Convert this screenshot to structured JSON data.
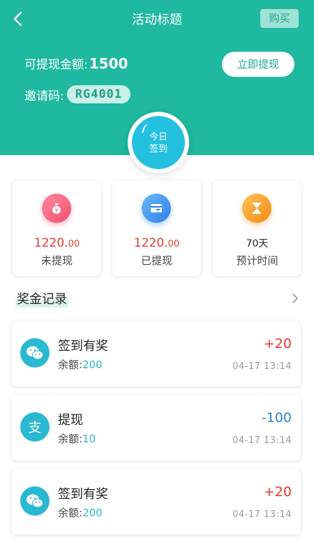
{
  "header": {
    "title": "活动标题",
    "buy_label": "购买",
    "amount_label": "可提现金额:",
    "amount_value": "1500",
    "withdraw_label": "立即提现",
    "invite_label": "邀请码:",
    "invite_code": "RG4001",
    "accent": "#1fb8a0"
  },
  "checkin": {
    "line1": "今日",
    "line2": "签到"
  },
  "stats": [
    {
      "icon": "money-bag-icon",
      "value_main": "1220.",
      "value_dec": "00",
      "label": "未提现",
      "color": "#f46a86"
    },
    {
      "icon": "card-icon",
      "value_main": "1220.",
      "value_dec": "00",
      "label": "已提现",
      "color": "#3e8fef"
    },
    {
      "icon": "hourglass-icon",
      "value": "70天",
      "label": "预计时间",
      "color": "#f5a623"
    }
  ],
  "records_section": {
    "title": "奖金记录"
  },
  "records": [
    {
      "icon": "wechat-icon",
      "title": "签到有奖",
      "balance_label": "余额:",
      "balance": "200",
      "amount": "+20",
      "time": "04-17  13:14"
    },
    {
      "icon": "alipay-icon",
      "title": "提现",
      "balance_label": "余额:",
      "balance": "10",
      "amount": "-100",
      "time": "04-17  13:14"
    },
    {
      "icon": "wechat-icon",
      "title": "签到有奖",
      "balance_label": "余额:",
      "balance": "200",
      "amount": "+20",
      "time": "04-17  13:14"
    }
  ]
}
